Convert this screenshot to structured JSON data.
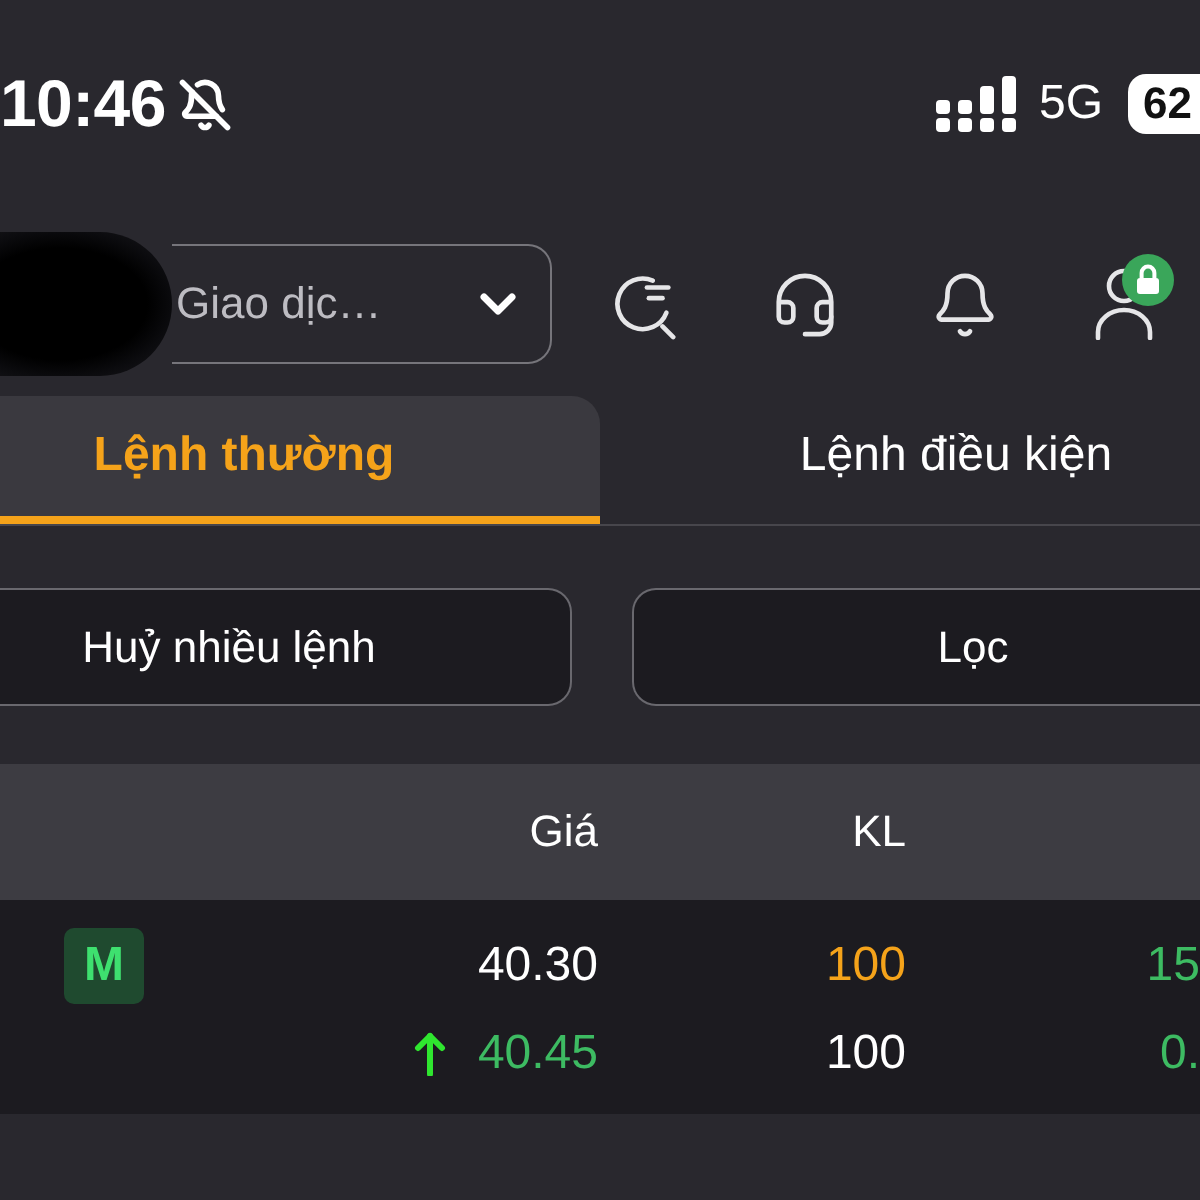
{
  "status_bar": {
    "time": "10:46",
    "silent": true,
    "network": "5G",
    "battery": "62"
  },
  "header": {
    "account_select": {
      "value": "Giao dịc…"
    },
    "profile": {
      "locked": true
    }
  },
  "tabs": [
    {
      "label": "Lệnh thường",
      "selected": true
    },
    {
      "label": "Lệnh điều kiện",
      "selected": false
    }
  ],
  "actions": [
    {
      "label": "Huỷ nhiều lệnh"
    },
    {
      "label": "Lọc"
    }
  ],
  "table": {
    "columns": [
      {
        "label": "Giá"
      },
      {
        "label": "KL"
      }
    ],
    "rows": [
      {
        "badge": "M",
        "lines": [
          {
            "price": {
              "text": "40.30",
              "color": "#ffffff"
            },
            "volume": {
              "text": "100",
              "color": "#f5a31a"
            },
            "column_3": {
              "text": "15",
              "color": "#3dbb62"
            }
          },
          {
            "rising": true,
            "price": {
              "text": "40.45",
              "color": "#3dbb62"
            },
            "volume": {
              "text": "100",
              "color": "#ffffff"
            },
            "column_3": {
              "text": "0.",
              "color": "#3dbb62"
            }
          }
        ]
      }
    ]
  }
}
